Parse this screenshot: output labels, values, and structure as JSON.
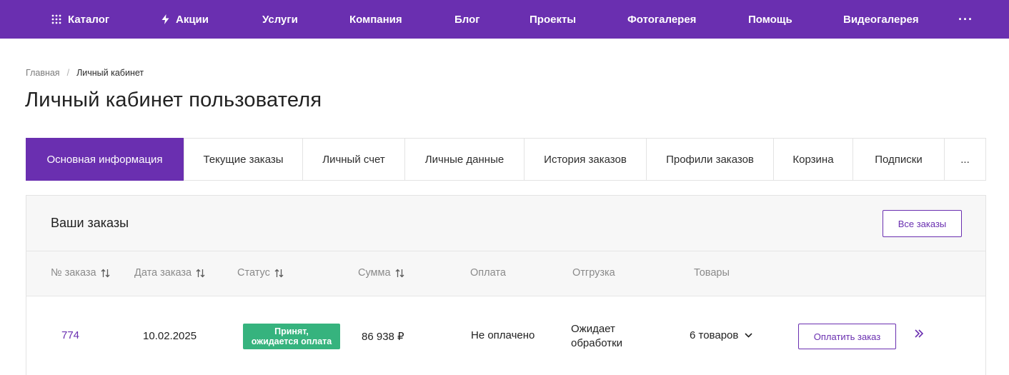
{
  "nav": {
    "items": [
      {
        "label": "Каталог",
        "icon": "grid-icon"
      },
      {
        "label": "Акции",
        "icon": "lightning-icon"
      },
      {
        "label": "Услуги"
      },
      {
        "label": "Компания"
      },
      {
        "label": "Блог"
      },
      {
        "label": "Проекты"
      },
      {
        "label": "Фотогалерея"
      },
      {
        "label": "Помощь"
      },
      {
        "label": "Видеогалерея"
      }
    ],
    "more": "···"
  },
  "breadcrumb": {
    "home": "Главная",
    "separator": "/",
    "current": "Личный кабинет"
  },
  "page_title": "Личный кабинет пользователя",
  "tabs": [
    {
      "label": "Основная информация",
      "active": true
    },
    {
      "label": "Текущие заказы"
    },
    {
      "label": "Личный счет"
    },
    {
      "label": "Личные данные"
    },
    {
      "label": "История заказов"
    },
    {
      "label": "Профили заказов"
    },
    {
      "label": "Корзина"
    },
    {
      "label": "Подписки"
    },
    {
      "label": "..."
    }
  ],
  "orders": {
    "title": "Ваши заказы",
    "all_button": "Все заказы",
    "columns": {
      "number": "№ заказа",
      "date": "Дата заказа",
      "status": "Статус",
      "sum": "Сумма",
      "payment": "Оплата",
      "shipping": "Отгрузка",
      "goods": "Товары"
    },
    "rows": [
      {
        "number": "774",
        "date": "10.02.2025",
        "status_line1": "Принят,",
        "status_line2": "ожидается оплата",
        "sum": "86 938 ₽",
        "payment": "Не оплачено",
        "shipping_line1": "Ожидает",
        "shipping_line2": "обработки",
        "goods": "6 товаров",
        "pay_button": "Оплатить заказ"
      }
    ]
  },
  "colors": {
    "brand": "#6a2fb0",
    "status_green": "#36b37e"
  }
}
